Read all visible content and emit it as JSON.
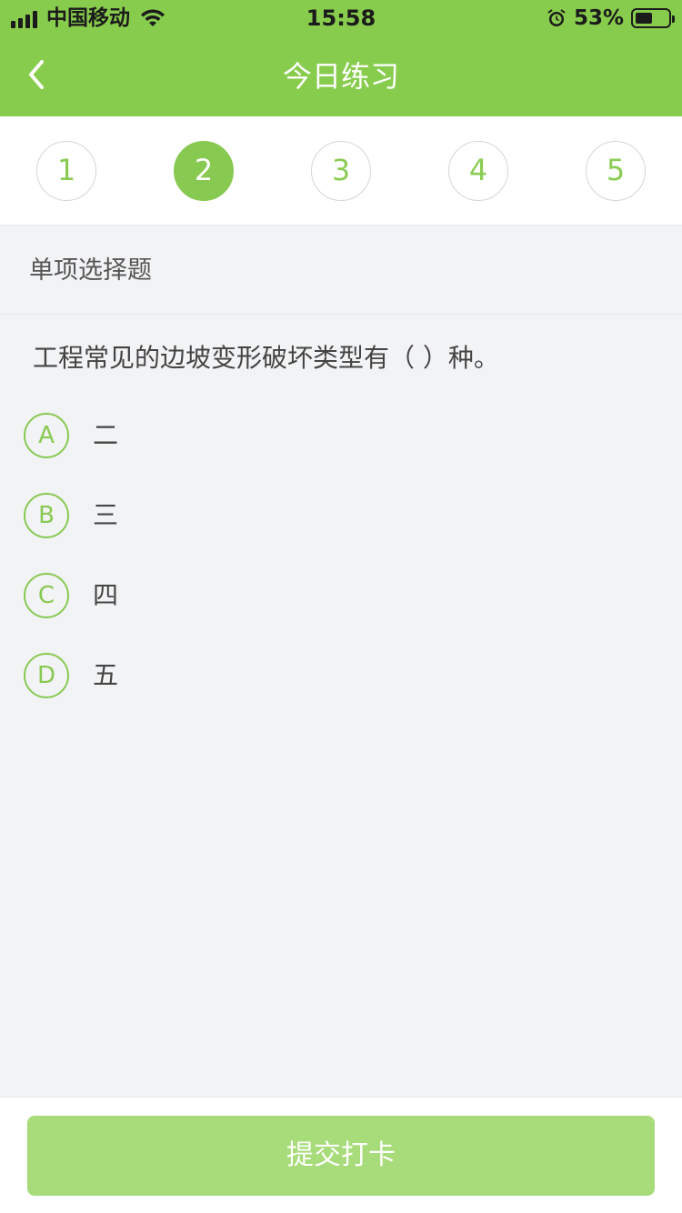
{
  "status_bar": {
    "carrier": "中国移动",
    "time": "15:58",
    "battery_percent": "53%",
    "battery_level": 0.53
  },
  "nav": {
    "title": "今日练习",
    "back_icon": "chevron-left-icon"
  },
  "tabs": {
    "items": [
      "1",
      "2",
      "3",
      "4",
      "5"
    ],
    "active_index": 1
  },
  "section": {
    "title": "单项选择题"
  },
  "question": {
    "text": "工程常见的边坡变形破坏类型有（    ）种。",
    "options": [
      {
        "letter": "A",
        "text": "二"
      },
      {
        "letter": "B",
        "text": "三"
      },
      {
        "letter": "C",
        "text": "四"
      },
      {
        "letter": "D",
        "text": "五"
      }
    ]
  },
  "footer": {
    "submit_label": "提交打卡"
  },
  "colors": {
    "brand_green": "#88cc4d",
    "submit_green": "#a8db79",
    "background": "#f2f3f5"
  }
}
